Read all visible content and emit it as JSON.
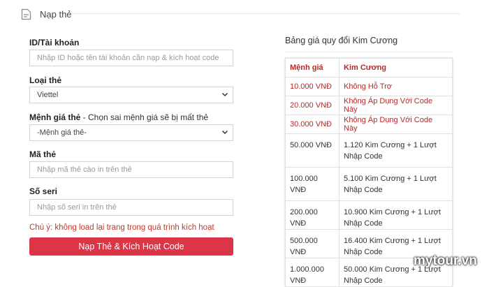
{
  "header": {
    "title": "Nạp thẻ",
    "icon": "document-icon"
  },
  "form": {
    "account_label": "ID/Tài khoản",
    "account_placeholder": "Nhập ID hoặc tên tài khoản cần nạp & kích hoạt code",
    "card_type_label": "Loại thẻ",
    "card_type_value": "Viettel",
    "denomination_label": "Mệnh giá thẻ",
    "denomination_note": " - Chọn sai mệnh giá sẽ bị mất thẻ",
    "denomination_value": "-Mệnh giá thẻ-",
    "card_code_label": "Mã thẻ",
    "card_code_placeholder": "Nhập mã thẻ cào in trên thẻ",
    "serial_label": "Số seri",
    "serial_placeholder": "Nhập số seri in trên thẻ",
    "warning": "Chú ý: không load lại trang trong quá trình kích hoạt",
    "submit_label": "Nạp Thẻ & Kích Hoạt Code"
  },
  "price_table": {
    "title": "Bảng giá quy đổi Kim Cương",
    "headers": [
      "Mệnh giá",
      "Kim Cương"
    ],
    "rows": [
      [
        "10.000 VNĐ",
        "Không Hỗ Trợ"
      ],
      [
        "20.000 VNĐ",
        "Không Áp Dụng Với Code Này"
      ],
      [
        "30.000 VNĐ",
        "Không Áp Dụng Với Code Này"
      ],
      [
        "50.000 VNĐ",
        "1.120 Kim Cương + 1 Lượt Nhập Code"
      ],
      [
        "100.000 VNĐ",
        "5.100 Kim Cương + 1 Lượt Nhập Code"
      ],
      [
        "200.000 VNĐ",
        "10.900 Kim Cương + 1 Lượt Nhập Code"
      ],
      [
        "500.000 VNĐ",
        "16.400 Kim Cương + 1 Lượt Nhập Code"
      ],
      [
        "1.000.000 VNĐ",
        "50.000 Kim Cương + 1 Lượt Nhập Code"
      ]
    ]
  },
  "watermark": "mytour.vn",
  "colors": {
    "accent_red": "#dc3545",
    "table_red_text": "#b52a28",
    "warning_text": "#c0392b"
  }
}
